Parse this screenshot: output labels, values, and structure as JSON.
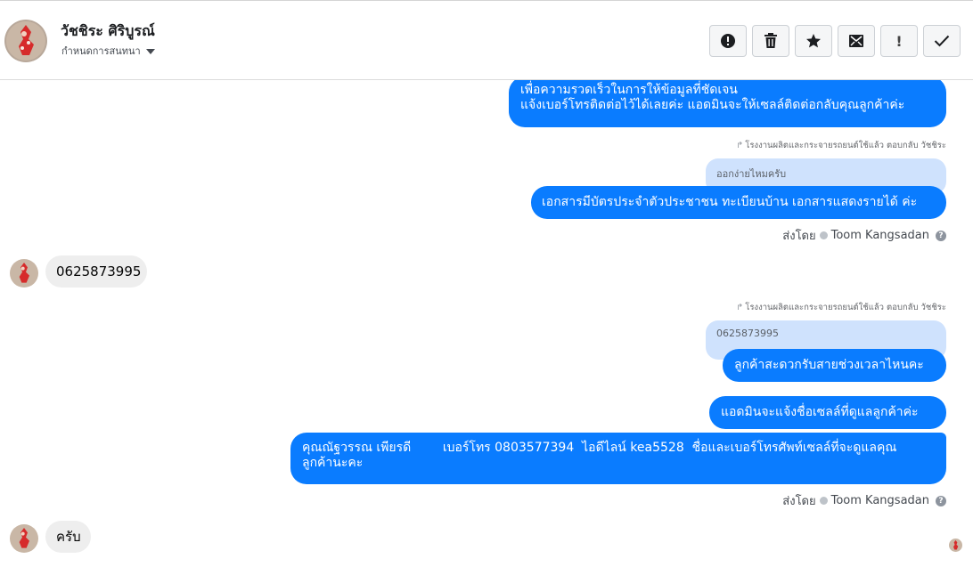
{
  "header": {
    "contact_name": "วัชชิระ ศิริบูรณ์",
    "assign_label": "กำหนดการสนทนา",
    "toolbar": [
      {
        "name": "report-spam-icon",
        "label": ""
      },
      {
        "name": "trash-icon",
        "label": ""
      },
      {
        "name": "star-icon",
        "label": ""
      },
      {
        "name": "mark-unread-icon",
        "label": ""
      },
      {
        "name": "follow-up-icon",
        "label": "!"
      },
      {
        "name": "done-check-icon",
        "label": ""
      }
    ]
  },
  "messages": {
    "m1_line1": "เพื่อความรวดเร็วในการให้ข้อมูลที่ชัดเจน",
    "m1_line2": "แจ้งเบอร์โทรติดต่อไว้ได้เลยค่ะ แอดมินจะให้เซลล์ติดต่อกลับคุณลูกค้าค่ะ",
    "reply1_meta": "โรงงานผลิตและกระจายรถยนต์ใช้แล้ว ตอบกลับ วัชชิระ",
    "reply1_quote": "ออกง่ายไหมครับ",
    "m2": "เอกสารมีบัตรประจำตัวประชาชน ทะเบียนบ้าน เอกสารแสดงรายได้ ค่ะ",
    "sent_by_1_prefix": "ส่งโดย",
    "sent_by_1_name": "Toom Kangsadan",
    "in1": "0625873995",
    "reply2_meta": "โรงงานผลิตและกระจายรถยนต์ใช้แล้ว ตอบกลับ วัชชิระ",
    "reply2_quote": "0625873995",
    "m3": "ลูกค้าสะดวกรับสายช่วงเวลาไหนคะ",
    "m4": "แอดมินจะแจ้งชื่อเซลล์ที่ดูแลลูกค้าค่ะ",
    "m5_line1": "คุณณัฐวรรณ เพียรดี        เบอร์โทร 0803577394  ไอดีไลน์ kea5528  ชื่อและเบอร์โทรศัพท์เซลล์ที่จะดูแลคุณ",
    "m5_line2": "ลูกค้านะคะ",
    "sent_by_2_prefix": "ส่งโดย",
    "sent_by_2_name": "Toom Kangsadan",
    "in2": "ครับ",
    "help_glyph": "?"
  },
  "colors": {
    "outgoing_bubble": "#0a7cff",
    "incoming_bubble": "#eeeeee",
    "quote_bubble": "#cfe2fd",
    "avatar_red": "#d62b2b"
  }
}
